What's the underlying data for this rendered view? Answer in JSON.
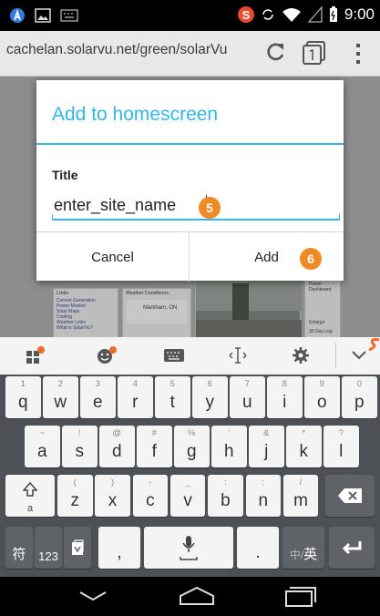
{
  "status_bar": {
    "time": "9:00",
    "app_badge": "S"
  },
  "browser": {
    "url": "cachelan.solarvu.net/green/solarVu"
  },
  "background_page": {
    "panel_headers": [
      "Links",
      "Weather Conditions"
    ],
    "links": [
      "Current Generation",
      "Power Monitor",
      "Solar Maps",
      "Cooling",
      "Weather Links",
      "What is Solar/Vu?"
    ],
    "weather_city": "Markham, ON",
    "right_panel_lines": [
      "Power",
      "Dashboard",
      "Enlarge",
      "30 Day Log"
    ]
  },
  "dialog": {
    "title": "Add to homescreen",
    "field_label": "Title",
    "field_value": "enter_site_name",
    "cancel_label": "Cancel",
    "add_label": "Add"
  },
  "annotations": {
    "step_input": "5",
    "step_add": "6",
    "color": "#f08a24"
  },
  "keyboard": {
    "row1": [
      {
        "main": "q",
        "hint": "1"
      },
      {
        "main": "w",
        "hint": "2"
      },
      {
        "main": "e",
        "hint": "3"
      },
      {
        "main": "r",
        "hint": "4"
      },
      {
        "main": "t",
        "hint": "5"
      },
      {
        "main": "y",
        "hint": "6"
      },
      {
        "main": "u",
        "hint": "7"
      },
      {
        "main": "i",
        "hint": "8"
      },
      {
        "main": "o",
        "hint": "9"
      },
      {
        "main": "p",
        "hint": "0"
      }
    ],
    "row2": [
      {
        "main": "a",
        "hint": "~"
      },
      {
        "main": "s",
        "hint": "!"
      },
      {
        "main": "d",
        "hint": "@"
      },
      {
        "main": "f",
        "hint": "#"
      },
      {
        "main": "g",
        "hint": "%"
      },
      {
        "main": "h",
        "hint": "'"
      },
      {
        "main": "j",
        "hint": "&"
      },
      {
        "main": "k",
        "hint": "*"
      },
      {
        "main": "l",
        "hint": "?"
      }
    ],
    "row3": [
      {
        "main": "z",
        "hint": "("
      },
      {
        "main": "x",
        "hint": ")"
      },
      {
        "main": "c",
        "hint": "-"
      },
      {
        "main": "v",
        "hint": "_"
      },
      {
        "main": "b",
        "hint": ":"
      },
      {
        "main": "n",
        "hint": ";"
      },
      {
        "main": "m",
        "hint": "/"
      }
    ],
    "shift_label": "a",
    "symbols_label": "符",
    "numbers_label": "123",
    "comma_label": ",",
    "period_label": ".",
    "lang_label_left": "中/",
    "lang_label_right": "英",
    "accent_color": "#33b5e5"
  }
}
